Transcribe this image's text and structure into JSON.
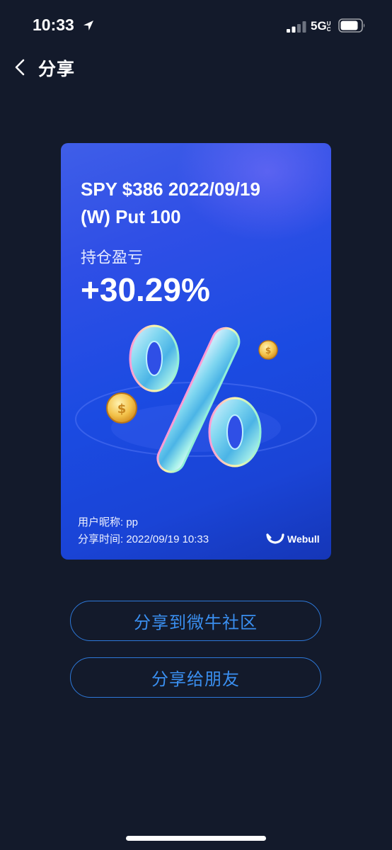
{
  "status_bar": {
    "time": "10:33",
    "network": "5G",
    "network_suffix": "UC"
  },
  "nav": {
    "title": "分享"
  },
  "card": {
    "contract_line1": "SPY $386 2022/09/19",
    "contract_line2": "(W) Put 100",
    "pnl_label": "持仓盈亏",
    "pnl_value": "+30.29%",
    "username": "用户昵称: pp",
    "share_time": "分享时间: 2022/09/19 10:33",
    "brand_name": "Webull",
    "art_icon": "percent-icon",
    "colors": {
      "card_top": "#3f5ee8",
      "card_bottom": "#1536b7"
    }
  },
  "actions": {
    "share_community": "分享到微牛社区",
    "share_friends": "分享给朋友"
  },
  "colors": {
    "background": "#131a2b",
    "accent": "#3a8ff0"
  }
}
